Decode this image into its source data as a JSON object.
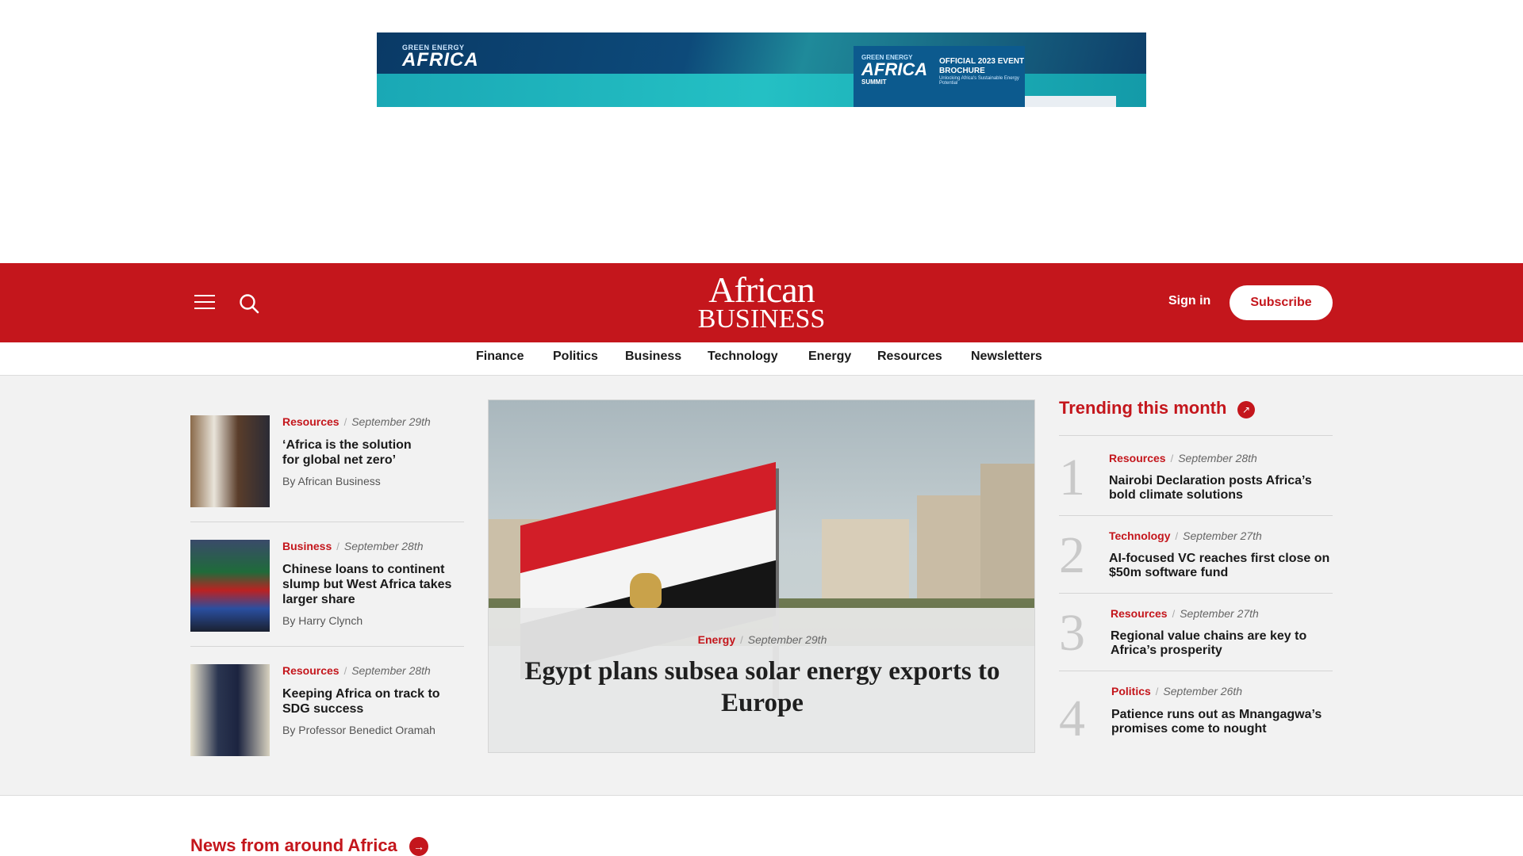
{
  "ad": {
    "logo_top": "GREEN ENERGY",
    "logo_main": "AFRICA",
    "brochure_top": "GREEN ENERGY",
    "brochure_main": "AFRICA",
    "brochure_sub": "SUMMIT",
    "brochure_title": "OFFICIAL 2023 EVENT BROCHURE",
    "brochure_caption": "Unlocking Africa's Sustainable Energy Potential"
  },
  "header": {
    "logo_line1": "African",
    "logo_line2": "BUSINESS",
    "signin_label": "Sign in",
    "subscribe_label": "Subscribe"
  },
  "nav": {
    "items": [
      {
        "label": "Finance"
      },
      {
        "label": "Politics"
      },
      {
        "label": "Business"
      },
      {
        "label": "Technology"
      },
      {
        "label": "Energy"
      },
      {
        "label": "Resources"
      },
      {
        "label": "Newsletters"
      }
    ]
  },
  "left_articles": [
    {
      "category": "Resources",
      "date": "September 29th",
      "title": "‘Africa is the solution for global net zero’",
      "author": "By African Business"
    },
    {
      "category": "Business",
      "date": "September 28th",
      "title": "Chinese loans to continent slump but West Africa takes larger share",
      "author": "By Harry Clynch"
    },
    {
      "category": "Resources",
      "date": "September 28th",
      "title": "Keeping Africa on track to SDG success",
      "author": "By Professor Benedict Oramah"
    }
  ],
  "feature": {
    "category": "Energy",
    "date": "September 29th",
    "title": "Egypt plans subsea solar energy exports to Europe"
  },
  "trending": {
    "heading": "Trending this month",
    "items": [
      {
        "rank": "1",
        "category": "Resources",
        "date": "September 28th",
        "title": "Nairobi Declaration posts Africa’s bold climate solutions"
      },
      {
        "rank": "2",
        "category": "Technology",
        "date": "September 27th",
        "title": "AI-focused VC reaches first close on $50m software fund"
      },
      {
        "rank": "3",
        "category": "Resources",
        "date": "September 27th",
        "title": "Regional value chains are key to Africa’s prosperity"
      },
      {
        "rank": "4",
        "category": "Politics",
        "date": "September 26th",
        "title": "Patience runs out as Mnangagwa’s promises come to nought"
      }
    ]
  },
  "news_section": {
    "heading": "News from around Africa"
  },
  "colors": {
    "brand_red": "#c4161c",
    "background_grey": "#f2f2f2"
  }
}
